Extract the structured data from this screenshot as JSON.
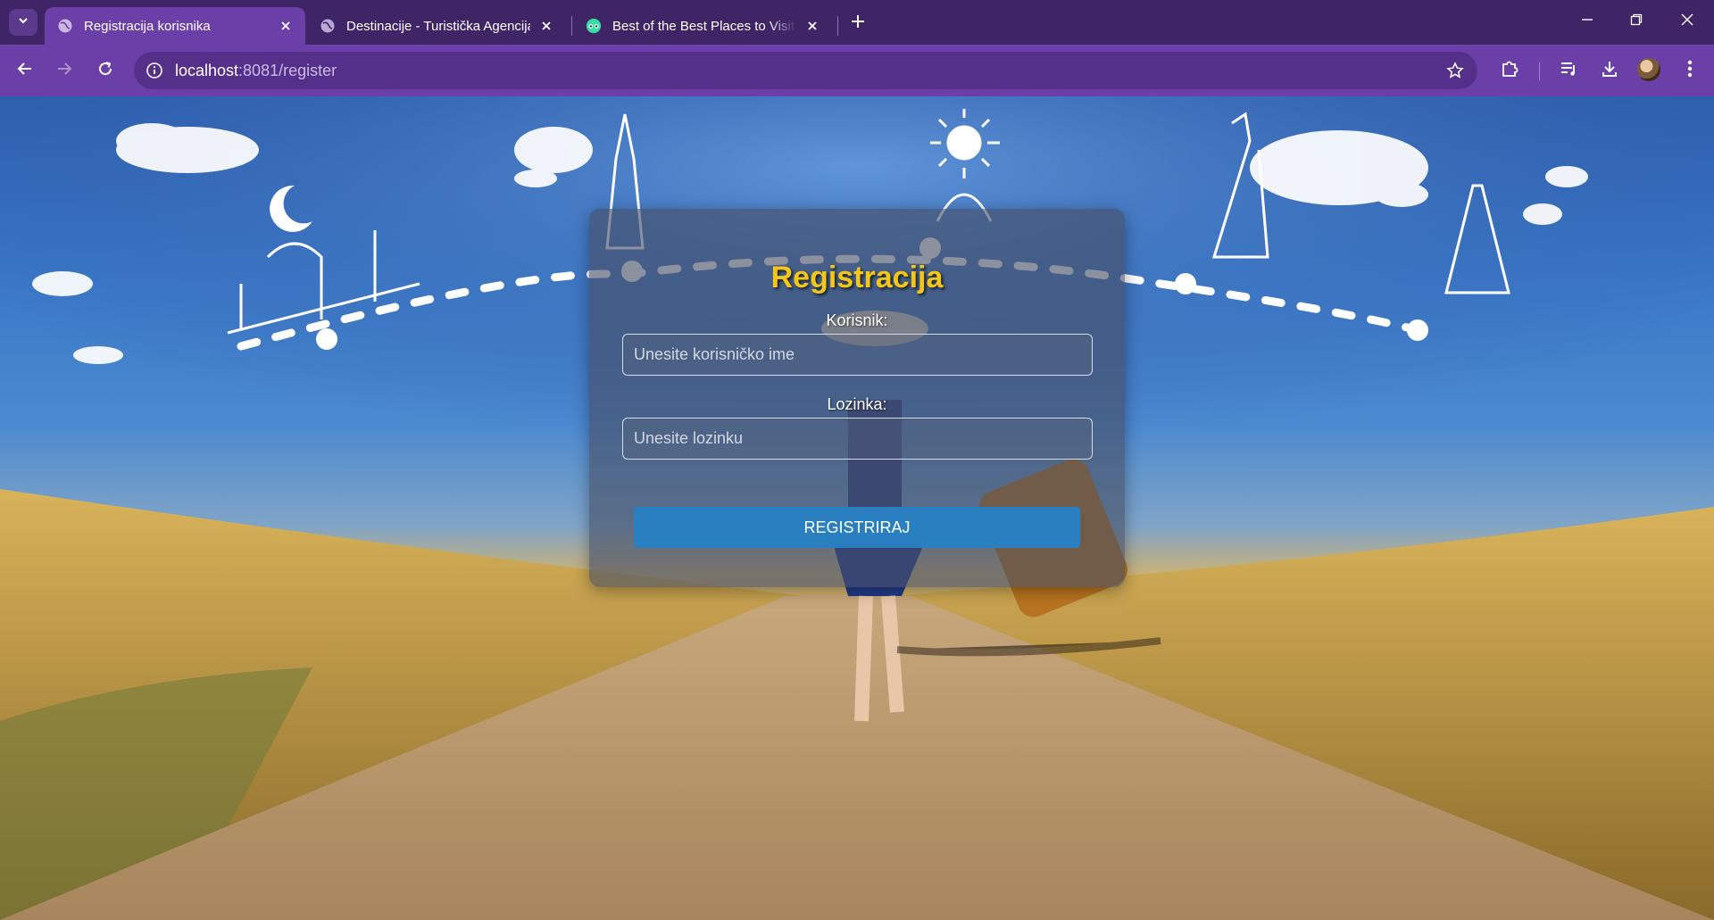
{
  "browser": {
    "tabs": [
      {
        "title": "Registracija korisnika",
        "active": true,
        "favicon": "globe-icon"
      },
      {
        "title": "Destinacije - Turistička Agencija",
        "active": false,
        "favicon": "globe-icon"
      },
      {
        "title": "Best of the Best Places to Visit in",
        "active": false,
        "favicon": "tripadvisor-icon"
      }
    ],
    "url_host": "localhost",
    "url_path": ":8081/register"
  },
  "form": {
    "title": "Registracija",
    "username_label": "Korisnik:",
    "username_placeholder": "Unesite korisničko ime",
    "username_value": "",
    "password_label": "Lozinka:",
    "password_placeholder": "Unesite lozinku",
    "password_value": "",
    "submit_label": "REGISTRIRAJ"
  },
  "colors": {
    "title": "#f5c518",
    "button": "#2a7fc0",
    "chrome_tabstrip": "#3f2466",
    "chrome_toolbar": "#6b3fa8"
  }
}
